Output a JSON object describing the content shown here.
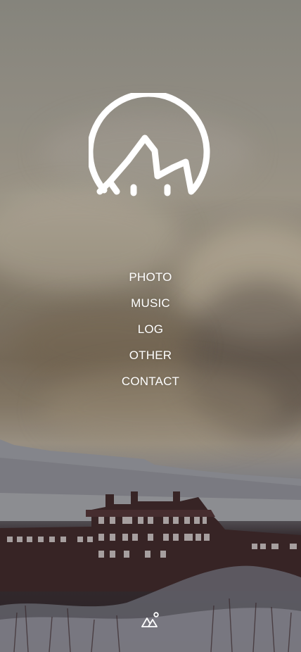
{
  "logo": {
    "icon": "mountain-circle-logo"
  },
  "nav": {
    "items": [
      {
        "label": "PHOTO"
      },
      {
        "label": "MUSIC"
      },
      {
        "label": "LOG"
      },
      {
        "label": "OTHER"
      },
      {
        "label": "CONTACT"
      }
    ]
  },
  "footer": {
    "icon": "shapes-icon"
  }
}
